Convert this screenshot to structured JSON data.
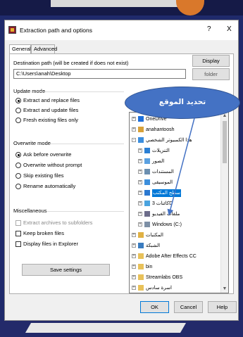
{
  "window": {
    "title": "Extraction path and options",
    "help_glyph": "?",
    "close_glyph": "X"
  },
  "tabs": [
    {
      "label": "General",
      "active": true
    },
    {
      "label": "Advanced",
      "active": false
    }
  ],
  "destination": {
    "label": "Destination path (will be created if does not exist)",
    "value": "C:\\Users\\anah\\Desktop",
    "display_button": "Display",
    "folder_button_partial": "folder"
  },
  "update_mode": {
    "title": "Update mode",
    "options": [
      {
        "label": "Extract and replace files",
        "selected": true
      },
      {
        "label": "Extract and update files",
        "selected": false
      },
      {
        "label": "Fresh existing files only",
        "selected": false
      }
    ]
  },
  "overwrite_mode": {
    "title": "Overwrite mode",
    "options": [
      {
        "label": "Ask before overwrite",
        "selected": true
      },
      {
        "label": "Overwrite without prompt",
        "selected": false
      },
      {
        "label": "Skip existing files",
        "selected": false
      },
      {
        "label": "Rename automatically",
        "selected": false
      }
    ]
  },
  "misc": {
    "title": "Miscellaneous",
    "options": [
      {
        "label": "Extract archives to subfolders",
        "checked": false,
        "disabled": true
      },
      {
        "label": "Keep broken files",
        "checked": false,
        "disabled": false
      },
      {
        "label": "Display files in Explorer",
        "checked": false,
        "disabled": false
      }
    ]
  },
  "save_settings": "Save settings",
  "tree": {
    "items": [
      {
        "label": "OneDrive",
        "icon": "cloud-icon",
        "level": 1,
        "expander": "+"
      },
      {
        "label": "anahantoosh",
        "icon": "user-folder-icon",
        "level": 1,
        "expander": "+"
      },
      {
        "label": "هذا الكمبيوتر الشخصي",
        "icon": "computer-icon",
        "level": 1,
        "expander": "-"
      },
      {
        "label": "التنزيلات",
        "icon": "download-icon",
        "level": 2,
        "expander": "+"
      },
      {
        "label": "الصور",
        "icon": "pictures-icon",
        "level": 2,
        "expander": "+"
      },
      {
        "label": "المستندات",
        "icon": "documents-icon",
        "level": 2,
        "expander": "+"
      },
      {
        "label": "الموسيقى",
        "icon": "music-icon",
        "level": 2,
        "expander": "+"
      },
      {
        "label": "سطح المكتب",
        "icon": "desktop-icon",
        "level": 2,
        "expander": "+",
        "selected": true
      },
      {
        "label": "كائنات 3D",
        "icon": "3d-objects-icon",
        "level": 2,
        "expander": "+"
      },
      {
        "label": "ملفات الفيديو",
        "icon": "video-icon",
        "level": 2,
        "expander": "+"
      },
      {
        "label": "Windows (C:)",
        "icon": "drive-icon",
        "level": 2,
        "expander": "+"
      },
      {
        "label": "المكتبات",
        "icon": "libraries-icon",
        "level": 1,
        "expander": "+"
      },
      {
        "label": "الشبكة",
        "icon": "network-icon",
        "level": 1,
        "expander": "+"
      },
      {
        "label": "Adobe After Effects CC",
        "icon": "folder-icon",
        "level": 1,
        "expander": "+"
      },
      {
        "label": "bin",
        "icon": "folder-icon",
        "level": 1,
        "expander": "+"
      },
      {
        "label": "Streamlabs OBS",
        "icon": "folder-icon",
        "level": 1,
        "expander": "+"
      },
      {
        "label": "اسرة سادس",
        "icon": "folder-icon",
        "level": 1,
        "expander": "+"
      }
    ]
  },
  "callout": {
    "text": "تحديد الموقع"
  },
  "footer": {
    "ok": "OK",
    "cancel": "Cancel",
    "help": "Help"
  },
  "colors": {
    "callout": "#4472c4",
    "selection": "#0078d7"
  }
}
